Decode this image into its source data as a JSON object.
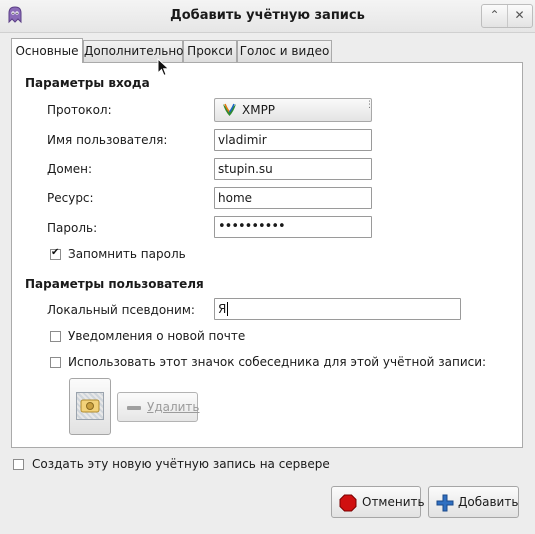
{
  "window": {
    "title": "Добавить учётную запись",
    "restore_glyph": "⌃",
    "close_glyph": "✕"
  },
  "tabs": [
    {
      "label": "Основные",
      "active": true
    },
    {
      "label": "Дополнительно",
      "active": false
    },
    {
      "label": "Прокси",
      "active": false
    },
    {
      "label": "Голос и видео",
      "active": false
    }
  ],
  "login": {
    "section": "Параметры входа",
    "protocol_label": "Протокол:",
    "protocol_value": "XMPP",
    "username_label": "Имя пользователя:",
    "username_value": "vladimir",
    "domain_label": "Домен:",
    "domain_value": "stupin.su",
    "resource_label": "Ресурс:",
    "resource_value": "home",
    "password_label": "Пароль:",
    "password_value": "••••••••••",
    "remember_label": "Запомнить пароль",
    "remember_checked": true
  },
  "user": {
    "section": "Параметры пользователя",
    "alias_label": "Локальный псевдоним:",
    "alias_value": "Я",
    "mail_notify_label": "Уведомления о новой почте",
    "mail_notify_checked": false,
    "buddy_icon_label": "Использовать этот значок собеседника для этой учётной записи:",
    "buddy_icon_checked": false,
    "remove_label": "Удалить"
  },
  "footer": {
    "create_on_server_label": "Создать эту новую учётную запись на сервере",
    "create_on_server_checked": false,
    "cancel_label": "Отменить",
    "add_label": "Добавить"
  },
  "colors": {
    "accent_icon": "#7a58a8",
    "cancel_red": "#d01010",
    "add_blue": "#2f6fc1"
  }
}
